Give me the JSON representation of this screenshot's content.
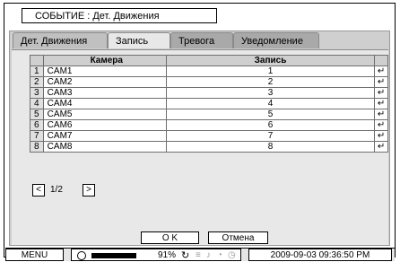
{
  "title": "СОБЫТИЕ : Дет. Движения",
  "tabs": [
    {
      "label": "Дет. Движения"
    },
    {
      "label": "Запись"
    },
    {
      "label": "Тревога"
    },
    {
      "label": "Уведомление"
    }
  ],
  "table": {
    "headers": {
      "camera": "Камера",
      "record": "Запись"
    },
    "rows": [
      {
        "num": "1",
        "cam": "CAM1",
        "rec": "1",
        "enter": "↵"
      },
      {
        "num": "2",
        "cam": "CAM2",
        "rec": "2",
        "enter": "↵"
      },
      {
        "num": "3",
        "cam": "CAM3",
        "rec": "3",
        "enter": "↵"
      },
      {
        "num": "4",
        "cam": "CAM4",
        "rec": "4",
        "enter": "↵"
      },
      {
        "num": "5",
        "cam": "CAM5",
        "rec": "5",
        "enter": "↵"
      },
      {
        "num": "6",
        "cam": "CAM6",
        "rec": "6",
        "enter": "↵"
      },
      {
        "num": "7",
        "cam": "CAM7",
        "rec": "7",
        "enter": "↵"
      },
      {
        "num": "8",
        "cam": "CAM8",
        "rec": "8",
        "enter": "↵"
      }
    ]
  },
  "pager": {
    "prev": "<",
    "page": "1/2",
    "next": ">"
  },
  "buttons": {
    "ok": "O K",
    "cancel": "Отмена"
  },
  "status": {
    "menu": "MENU",
    "hdd_percent": "91%",
    "hdd_fill": 0.91,
    "datetime": "2009-09-03 09:36:50 PM",
    "icons": [
      "refresh-icon",
      "network-icon",
      "alarm-icon",
      "backup-icon",
      "clock-icon"
    ]
  }
}
